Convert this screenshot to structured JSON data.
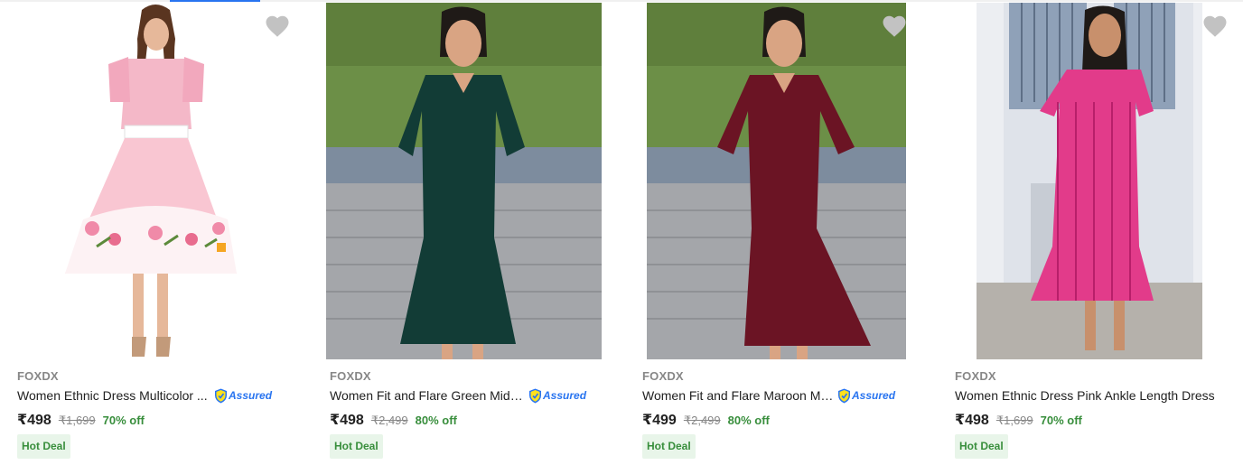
{
  "products": [
    {
      "brand": "FOXDX",
      "title": "Women Ethnic Dress Multicolor ...",
      "assured": true,
      "assured_label": "Assured",
      "price": "₹498",
      "mrp": "₹1,699",
      "discount": "70% off",
      "badge": "Hot Deal",
      "wishlist_visible": true
    },
    {
      "brand": "FOXDX",
      "title": "Women Fit and Flare Green Midi/...",
      "assured": true,
      "assured_label": "Assured",
      "price": "₹498",
      "mrp": "₹2,499",
      "discount": "80% off",
      "badge": "Hot Deal",
      "wishlist_visible": false
    },
    {
      "brand": "FOXDX",
      "title": "Women Fit and Flare Maroon Mi...",
      "assured": true,
      "assured_label": "Assured",
      "price": "₹499",
      "mrp": "₹2,499",
      "discount": "80% off",
      "badge": "Hot Deal",
      "wishlist_visible": true
    },
    {
      "brand": "FOXDX",
      "title": "Women Ethnic Dress Pink Ankle Length Dress",
      "assured": false,
      "assured_label": "",
      "price": "₹498",
      "mrp": "₹1,699",
      "discount": "70% off",
      "badge": "Hot Deal",
      "wishlist_visible": true
    }
  ],
  "icons": {
    "wishlist": "heart-icon",
    "assured": "assured-shield-icon"
  },
  "colors": {
    "accent": "#2874f0",
    "discount": "#388e3c",
    "badge_bg": "#e8f5e9",
    "muted": "#878787",
    "heart": "#c2c2c2"
  }
}
